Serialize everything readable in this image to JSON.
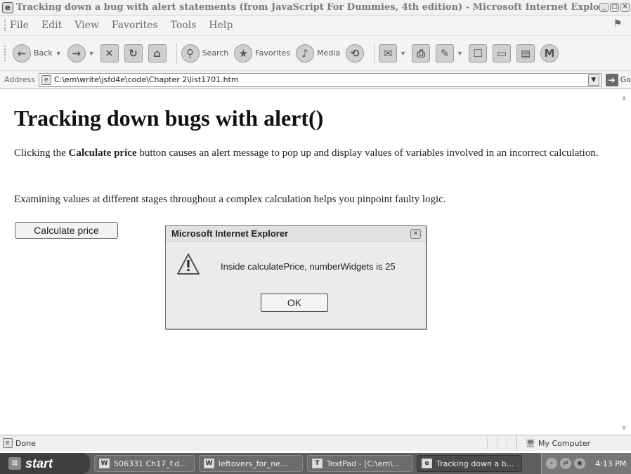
{
  "window": {
    "title": "Tracking down a bug with alert statements (from JavaScript For Dummies, 4th edition) - Microsoft Internet Explo...",
    "app_icon": "ie-page-icon"
  },
  "menu": [
    "File",
    "Edit",
    "View",
    "Favorites",
    "Tools",
    "Help"
  ],
  "toolbar": {
    "back_label": "Back",
    "search_label": "Search",
    "favorites_label": "Favorites",
    "media_label": "Media"
  },
  "address": {
    "label": "Address",
    "value": "C:\\em\\write\\jsfd4e\\code\\Chapter 2\\list1701.htm",
    "go_label": "Go"
  },
  "page": {
    "heading": "Tracking down bugs with alert()",
    "p1_before": "Clicking the ",
    "p1_bold": "Calculate price",
    "p1_after": " button causes an alert message to pop up and display values of variables involved in an incorrect calculation.",
    "p2": "Examining values at different stages throughout a complex calculation helps you pinpoint faulty logic.",
    "button_label": "Calculate price"
  },
  "dialog": {
    "title": "Microsoft Internet Explorer",
    "message": "Inside calculatePrice, numberWidgets is 25",
    "ok_label": "OK"
  },
  "status": {
    "text": "Done",
    "zone": "My Computer"
  },
  "taskbar": {
    "start_label": "start",
    "tasks": [
      {
        "label": "506331 Ch17_f.d..."
      },
      {
        "label": "leftovers_for_ne..."
      },
      {
        "label": "TextPad - [C:\\em\\..."
      },
      {
        "label": "Tracking down a b..."
      }
    ],
    "clock": "4:13 PM"
  }
}
